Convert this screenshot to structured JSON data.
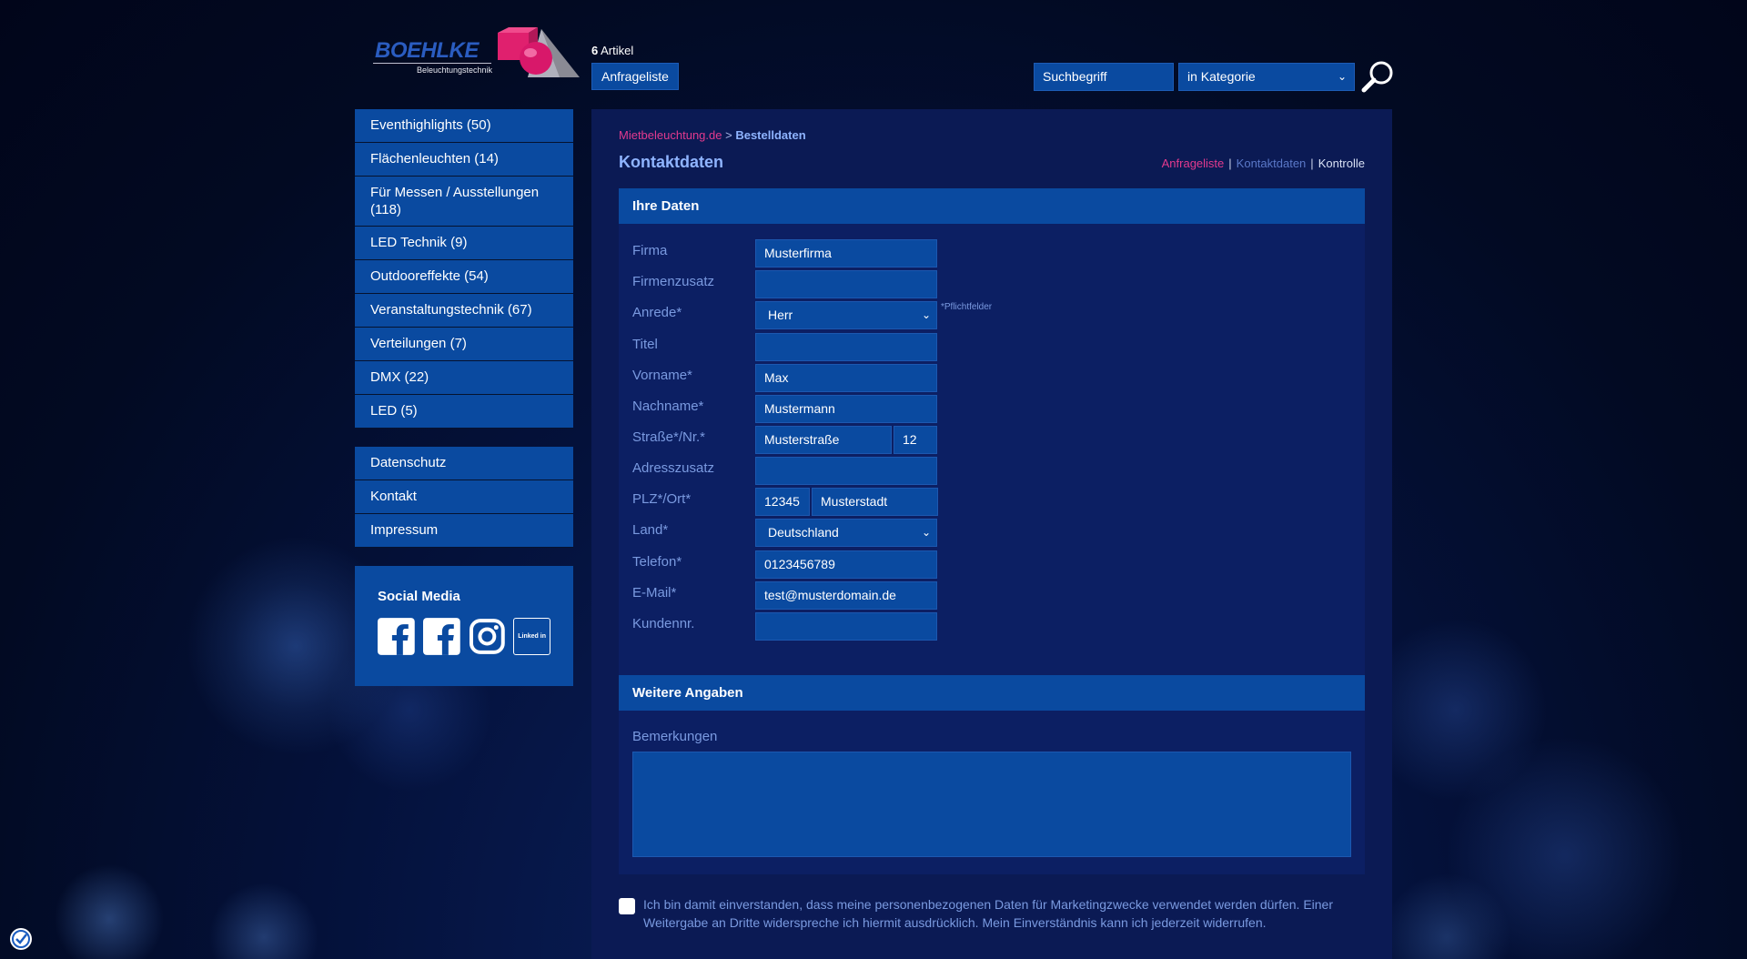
{
  "header": {
    "logo_text": "BOEHLKE",
    "logo_subtitle": "Beleuchtungstechnik",
    "cart_count": "6",
    "cart_label": "Artikel",
    "inquiry_button": "Anfrageliste",
    "search_placeholder": "Suchbegriff",
    "category_select": "in Kategorie",
    "search_icon": "magnifier-icon"
  },
  "sidebar": {
    "categories": [
      "Eventhighlights (50)",
      "Flächenleuchten (14)",
      "Für Messen / Ausstellungen (118)",
      "LED Technik (9)",
      "Outdooreffekte (54)",
      "Veranstaltungstechnik (67)",
      "Verteilungen (7)",
      "DMX (22)",
      "LED (5)"
    ],
    "pages": [
      "Datenschutz",
      "Kontakt",
      "Impressum"
    ],
    "social_title": "Social Media",
    "social_icons": [
      "facebook-icon",
      "facebook-icon",
      "instagram-icon",
      "linkedin-icon"
    ],
    "linkedin_label": "Linked in"
  },
  "main": {
    "breadcrumb_home": "Mietbeleuchtung.de",
    "breadcrumb_sep": ">",
    "breadcrumb_current": "Bestelldaten",
    "title": "Kontaktdaten",
    "steps": [
      "Anfrageliste",
      "Kontaktdaten",
      "Kontrolle"
    ],
    "step_sep": "|",
    "section1_title": "Ihre Daten",
    "required_note": "*Pflichtfelder",
    "labels": {
      "firma": "Firma",
      "firmenzusatz": "Firmenzusatz",
      "anrede": "Anrede*",
      "titel": "Titel",
      "vorname": "Vorname*",
      "nachname": "Nachname*",
      "strasse": "Straße*/Nr.*",
      "adresszusatz": "Adresszusatz",
      "plzort": "PLZ*/Ort*",
      "land": "Land*",
      "telefon": "Telefon*",
      "email": "E-Mail*",
      "kundennr": "Kundennr."
    },
    "values": {
      "firma": "Musterfirma",
      "firmenzusatz": "",
      "anrede": "Herr",
      "titel": "",
      "vorname": "Max",
      "nachname": "Mustermann",
      "strasse": "Musterstraße",
      "hausnr": "12",
      "adresszusatz": "",
      "plz": "12345",
      "ort": "Musterstadt",
      "land": "Deutschland",
      "telefon": "0123456789",
      "email": "test@musterdomain.de",
      "kundennr": ""
    },
    "section2_title": "Weitere Angaben",
    "remarks_label": "Bemerkungen",
    "remarks_value": "",
    "consent_text": "Ich bin damit einverstanden, dass meine personenbezogenen Daten für Marketingzwecke verwendet werden dürfen. Einer Weitergabe an Dritte widerspreche ich hiermit ausdrücklich. Mein Einverständnis kann ich jederzeit widerrufen.",
    "consent_checked": false
  },
  "colors": {
    "accent": "#0a4aa0",
    "link_pink": "#e33a8e",
    "label_blue": "#7a9ae0",
    "panel": "#0b1a54"
  }
}
